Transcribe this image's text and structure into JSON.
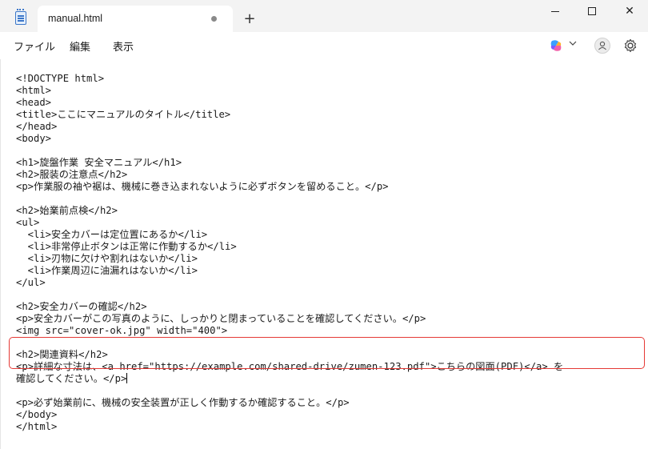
{
  "window": {
    "tab_title": "manual.html",
    "new_tab": "+",
    "min_label": "",
    "close_label": "✕"
  },
  "menu": {
    "file": "ファイル",
    "edit": "編集",
    "view": "表示"
  },
  "editor": {
    "lines": [
      "<!DOCTYPE html>",
      "<html>",
      "<head>",
      "<title>ここにマニュアルのタイトル</title>",
      "</head>",
      "<body>",
      "",
      "<h1>旋盤作業 安全マニュアル</h1>",
      "<h2>服装の注意点</h2>",
      "<p>作業服の袖や裾は、機械に巻き込まれないように必ずボタンを留めること。</p>",
      "",
      "<h2>始業前点検</h2>",
      "<ul>",
      "  <li>安全カバーは定位置にあるか</li>",
      "  <li>非常停止ボタンは正常に作動するか</li>",
      "  <li>刃物に欠けや割れはないか</li>",
      "  <li>作業周辺に油漏れはないか</li>",
      "</ul>",
      "",
      "<h2>安全カバーの確認</h2>",
      "<p>安全カバーがこの写真のように、しっかりと閉まっていることを確認してください。</p>",
      "<img src=\"cover-ok.jpg\" width=\"400\">",
      "",
      "<h2>関連資料</h2>",
      "<p>詳細な寸法は、<a href=\"https://example.com/shared-drive/zumen-123.pdf\">こちらの図面(PDF)</a> を",
      "確認してください。</p>",
      "",
      "<p>必ず始業前に、機械の安全装置が正しく作動するか確認すること。</p>",
      "</body>",
      "</html>"
    ]
  },
  "colors": {
    "highlight_border": "#e53935",
    "titlebar_bg": "#f3f3f3"
  },
  "icons": {
    "app": "notepad-icon",
    "copilot": "copilot-icon",
    "account": "account-icon",
    "settings": "gear-icon"
  }
}
